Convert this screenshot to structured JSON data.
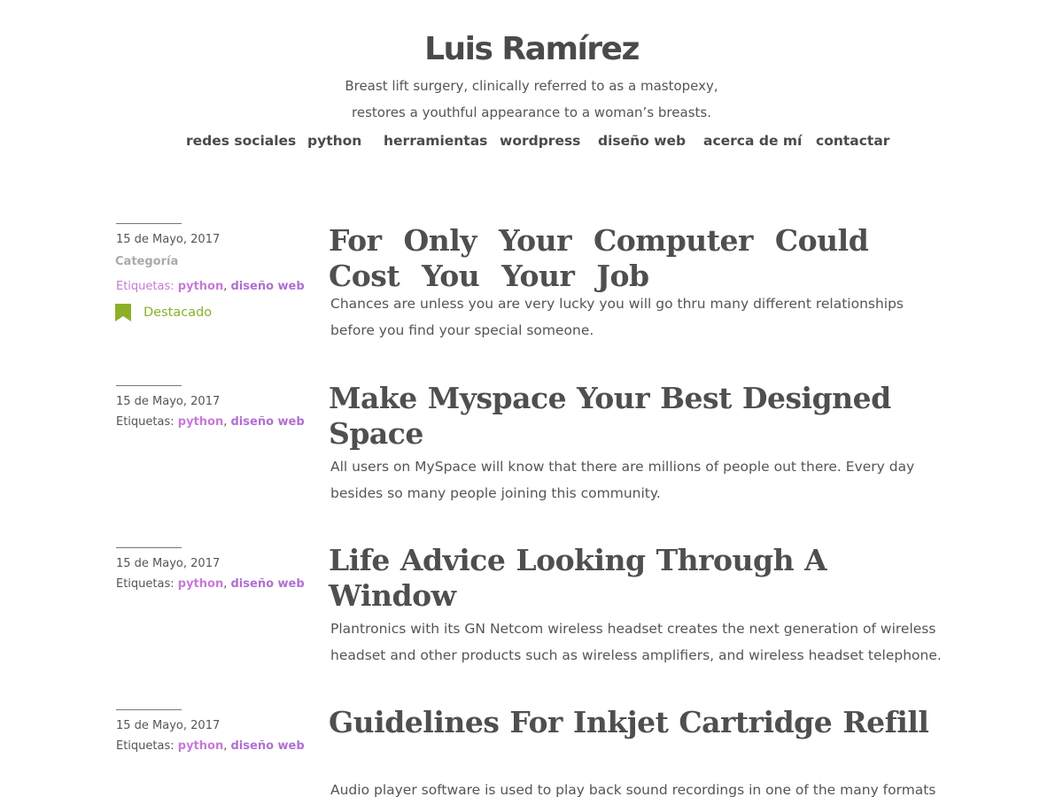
{
  "site": {
    "title": "Luis Ramírez",
    "description_line1": "Breast lift surgery, clinically referred to as a mastopexy,",
    "description_line2": "restores a youthful appearance to a woman’s breasts."
  },
  "nav": {
    "items": [
      {
        "label": "redes sociales"
      },
      {
        "label": "python"
      },
      {
        "label": "herramientas"
      },
      {
        "label": "wordpress"
      },
      {
        "label": "diseño web"
      },
      {
        "label": "acerca de mí"
      },
      {
        "label": "contactar"
      }
    ]
  },
  "posts": [
    {
      "date": "15 de Mayo, 2017",
      "category_label": "Categoría",
      "tags_label": "Etiquetas:",
      "tags": [
        "python",
        "diseño web"
      ],
      "tag_separator": ",",
      "featured_label": "Destacado",
      "title": "For   Only Your Computer   Could Cost You Your Job",
      "excerpt": "Chances are unless you are very lucky you will go thru many different relationships before you find your special someone."
    },
    {
      "date": "15 de Mayo, 2017",
      "tags_label": "Etiquetas:",
      "tags": [
        "python",
        "diseño web"
      ],
      "tag_separator": ",",
      "title": "Make Myspace Your Best Designed Space",
      "excerpt": "All users on MySpace will know that there are millions of people out there. Every day besides so many people joining this community."
    },
    {
      "date": "15 de Mayo, 2017",
      "tags_label": "Etiquetas:",
      "tags": [
        "python",
        "diseño web"
      ],
      "tag_separator": ",",
      "title": "Life Advice Looking Through A Window",
      "excerpt": "Plantronics with its GN Netcom wireless headset creates the next generation of wireless headset and other products such as wireless amplifiers, and wireless headset telephone."
    },
    {
      "date": "15 de Mayo, 2017",
      "tags_label": "Etiquetas:",
      "tags": [
        "python",
        "diseño web"
      ],
      "tag_separator": ",",
      "title": "Guidelines For Inkjet Cartridge Refill",
      "excerpt": "Audio player software is used to play back sound recordings in one of the many formats"
    }
  ],
  "colors": {
    "text": "#555555",
    "heading": "#4f4f4f",
    "tag_accent": "#b06fd0",
    "featured_accent": "#8cb02a"
  },
  "icons": {
    "featured": "bookmark-icon"
  }
}
